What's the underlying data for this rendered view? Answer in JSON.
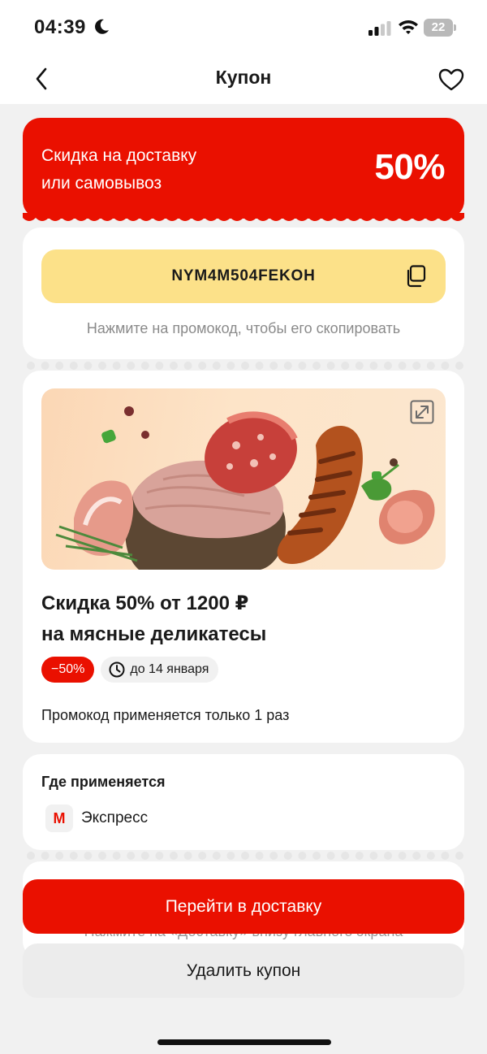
{
  "status_bar": {
    "time": "04:39",
    "battery": "22"
  },
  "nav": {
    "title": "Купон"
  },
  "deal": {
    "line1": "Скидка на доставку",
    "line2": "или самовывоз",
    "percent": "50%"
  },
  "promo": {
    "code": "NYM4M504FEKOH",
    "hint": "Нажмите на промокод, чтобы его скопировать"
  },
  "offer": {
    "title_line1": "Скидка 50% от 1200 ₽",
    "title_line2": "на мясные деликатесы",
    "discount_badge": "−50%",
    "date_badge": "до 14 января",
    "usage_note": "Промокод применяется только 1 раз"
  },
  "where": {
    "title": "Где применяется",
    "logo_letter": "M",
    "place": "Экспресс"
  },
  "footer": {
    "hint": "Нажмите на «Доставку» внизу главного экрана",
    "primary_button": "Перейти в доставку",
    "secondary_button": "Удалить купон"
  },
  "icons": [
    "back-icon",
    "heart-icon",
    "copy-icon",
    "expand-icon",
    "clock-icon",
    "moon-icon",
    "signal-icon",
    "wifi-icon",
    "battery-icon"
  ],
  "colors": {
    "accent": "#ea1000",
    "promo_bg": "#fce189",
    "background": "#f1f1f1"
  }
}
